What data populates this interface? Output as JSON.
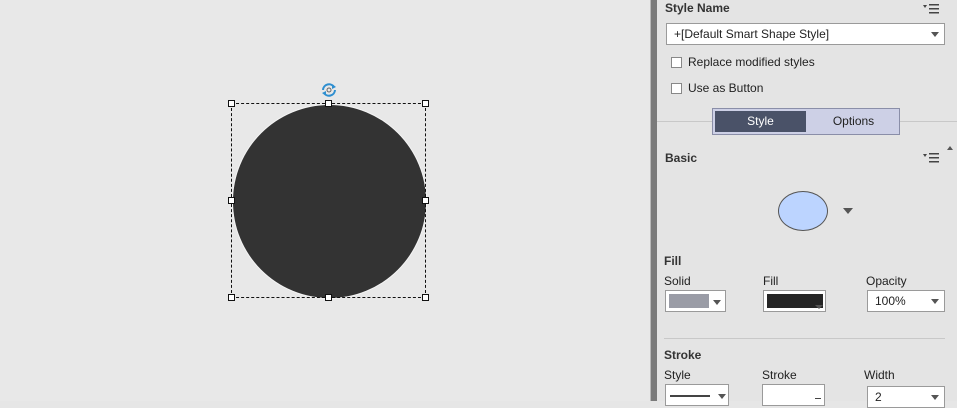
{
  "style_name": {
    "title": "Style Name",
    "selected": "+[Default Smart Shape Style]",
    "replace_label": "Replace modified styles",
    "button_label": "Use as Button"
  },
  "tabs": [
    {
      "label": "Style",
      "active": true
    },
    {
      "label": "Options",
      "active": false
    }
  ],
  "basic": {
    "title": "Basic"
  },
  "fill": {
    "title": "Fill",
    "type_label": "Solid",
    "fill_label": "Fill",
    "opacity_label": "Opacity",
    "opacity_value": "100%",
    "type_color": "#9a9ca6",
    "fill_color": "#262626"
  },
  "stroke": {
    "title": "Stroke",
    "style_label": "Style",
    "stroke_label": "Stroke",
    "width_label": "Width",
    "width_value": "2"
  },
  "canvas": {
    "shape_color": "#333333",
    "preview_color": "#bcd4ff"
  },
  "icons": [
    "rotate-icon",
    "menu-icon",
    "chevron-down-icon"
  ]
}
